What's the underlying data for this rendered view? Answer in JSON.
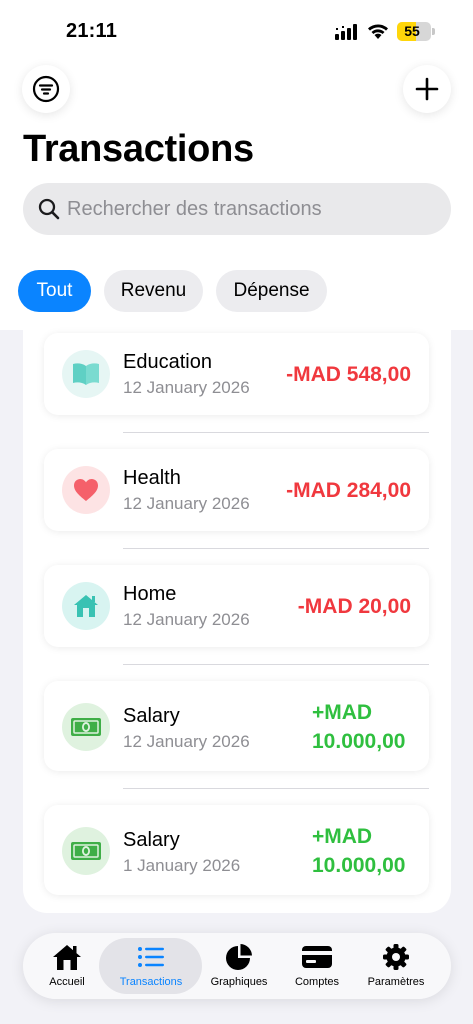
{
  "status_bar": {
    "time": "21:11",
    "battery": "55",
    "battery_level": 0.55
  },
  "header": {
    "title": "Transactions"
  },
  "search": {
    "placeholder": "Rechercher des transactions",
    "value": ""
  },
  "filters": [
    {
      "label": "Tout",
      "selected": true
    },
    {
      "label": "Revenu",
      "selected": false
    },
    {
      "label": "Dépense",
      "selected": false
    }
  ],
  "transactions": [
    {
      "name": "Education",
      "date": "12 January 2026",
      "amount": "-MAD 548,00",
      "type": "expense",
      "icon": "book-icon"
    },
    {
      "name": "Health",
      "date": "12 January 2026",
      "amount": "-MAD 284,00",
      "type": "expense",
      "icon": "heart-icon"
    },
    {
      "name": "Home",
      "date": "12 January 2026",
      "amount": "-MAD 20,00",
      "type": "expense",
      "icon": "house-icon"
    },
    {
      "name": "Salary",
      "date": "12 January 2026",
      "amount_line1": "+MAD",
      "amount_line2": "10.000,00",
      "type": "income",
      "icon": "banknote-icon"
    },
    {
      "name": "Salary",
      "date": "1 January 2026",
      "amount_line1": "+MAD",
      "amount_line2": "10.000,00",
      "type": "income",
      "icon": "banknote-icon"
    }
  ],
  "tabbar": {
    "tabs": [
      {
        "label": "Accueil",
        "icon": "home-icon",
        "selected": false
      },
      {
        "label": "Transactions",
        "icon": "list-icon",
        "selected": true
      },
      {
        "label": "Graphiques",
        "icon": "pie-chart-icon",
        "selected": false
      },
      {
        "label": "Comptes",
        "icon": "credit-card-icon",
        "selected": false
      },
      {
        "label": "Paramètres",
        "icon": "gear-icon",
        "selected": false
      }
    ]
  },
  "colors": {
    "accent": "#0a84ff",
    "expense": "#f0383e",
    "income": "#2fbf3f",
    "education_bg": "#e6f6f4",
    "health_bg": "#fde3e4",
    "home_bg": "#d8f4f1",
    "salary_bg": "#dff2df"
  }
}
